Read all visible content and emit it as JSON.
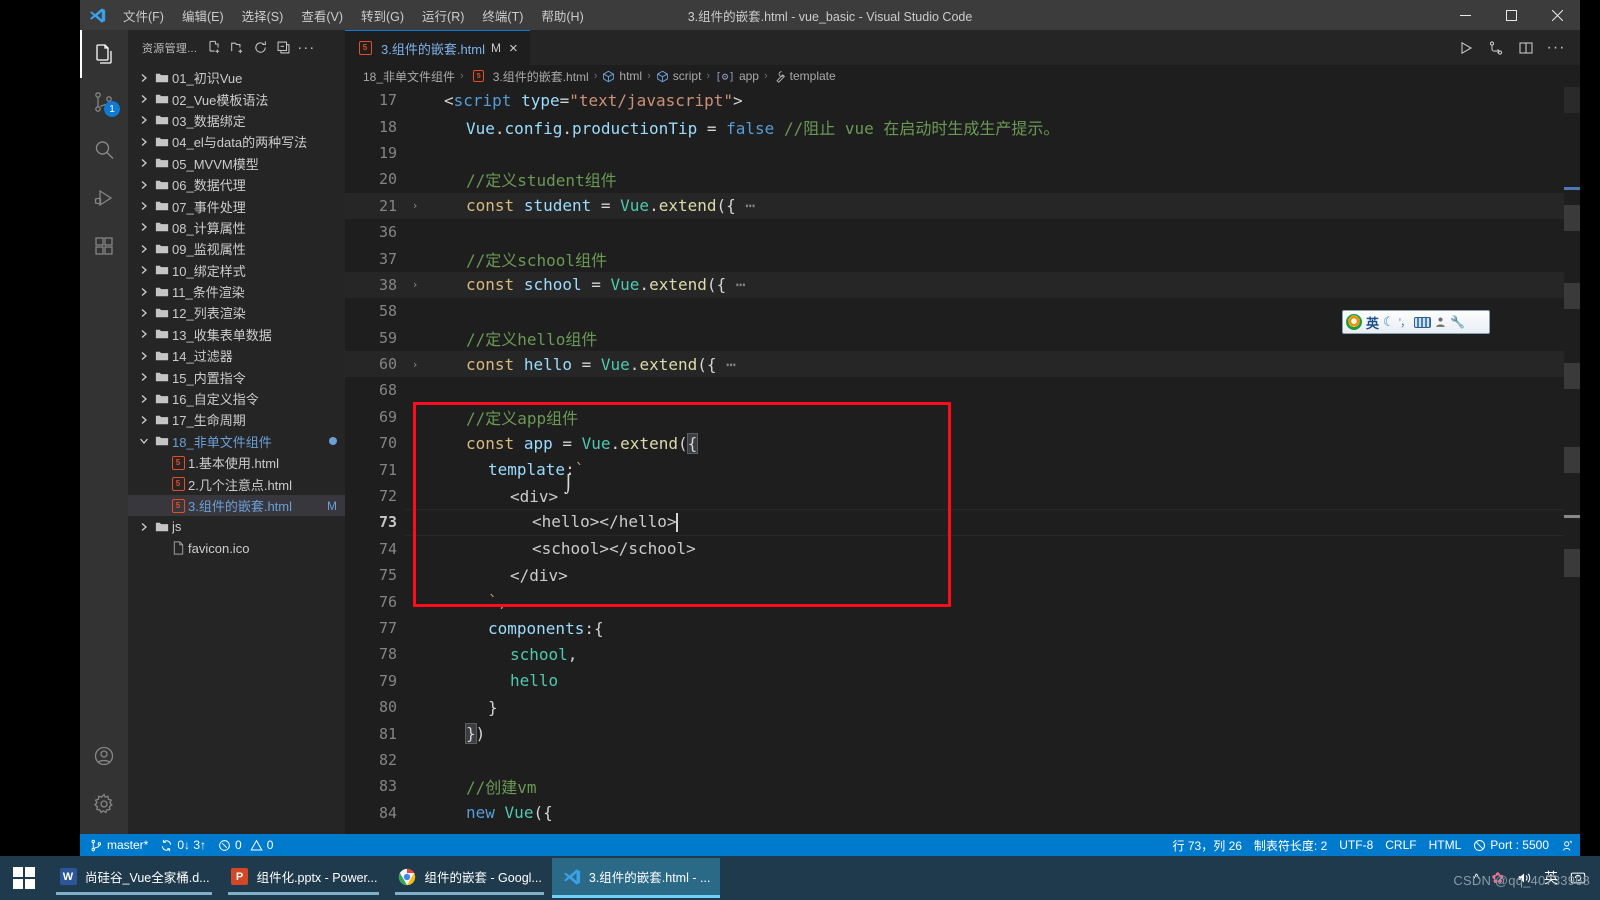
{
  "window": {
    "title": "3.组件的嵌套.html - vue_basic - Visual Studio Code",
    "menus": [
      "文件(F)",
      "编辑(E)",
      "选择(S)",
      "查看(V)",
      "转到(G)",
      "运行(R)",
      "终端(T)",
      "帮助(H)"
    ],
    "controls": {
      "minimize": "minimize-icon",
      "maximize": "maximize-icon",
      "close": "close-icon"
    }
  },
  "activitybar": {
    "items": [
      {
        "name": "explorer",
        "icon": "files-icon",
        "active": true,
        "badge": ""
      },
      {
        "name": "source-control",
        "icon": "source-control-icon",
        "active": false,
        "badge": "1"
      },
      {
        "name": "search",
        "icon": "search-icon",
        "active": false,
        "badge": ""
      },
      {
        "name": "run-and-debug",
        "icon": "debug-icon",
        "active": false,
        "badge": ""
      },
      {
        "name": "extensions",
        "icon": "extensions-icon",
        "active": false,
        "badge": ""
      }
    ],
    "bottom": [
      {
        "name": "accounts",
        "icon": "account-icon"
      },
      {
        "name": "manage",
        "icon": "gear-icon"
      }
    ]
  },
  "sidebar": {
    "title": "资源管理...",
    "actions": [
      "new-file-icon",
      "new-folder-icon",
      "refresh-icon",
      "collapse-all-icon",
      "more-icon"
    ],
    "tree": [
      {
        "label": "01_初识Vue",
        "type": "folder",
        "expanded": false,
        "indent": 0
      },
      {
        "label": "02_Vue模板语法",
        "type": "folder",
        "expanded": false,
        "indent": 0
      },
      {
        "label": "03_数据绑定",
        "type": "folder",
        "expanded": false,
        "indent": 0
      },
      {
        "label": "04_el与data的两种写法",
        "type": "folder",
        "expanded": false,
        "indent": 0
      },
      {
        "label": "05_MVVM模型",
        "type": "folder",
        "expanded": false,
        "indent": 0
      },
      {
        "label": "06_数据代理",
        "type": "folder",
        "expanded": false,
        "indent": 0
      },
      {
        "label": "07_事件处理",
        "type": "folder",
        "expanded": false,
        "indent": 0
      },
      {
        "label": "08_计算属性",
        "type": "folder",
        "expanded": false,
        "indent": 0
      },
      {
        "label": "09_监视属性",
        "type": "folder",
        "expanded": false,
        "indent": 0
      },
      {
        "label": "10_绑定样式",
        "type": "folder",
        "expanded": false,
        "indent": 0
      },
      {
        "label": "11_条件渲染",
        "type": "folder",
        "expanded": false,
        "indent": 0
      },
      {
        "label": "12_列表渲染",
        "type": "folder",
        "expanded": false,
        "indent": 0
      },
      {
        "label": "13_收集表单数据",
        "type": "folder",
        "expanded": false,
        "indent": 0
      },
      {
        "label": "14_过滤器",
        "type": "folder",
        "expanded": false,
        "indent": 0
      },
      {
        "label": "15_内置指令",
        "type": "folder",
        "expanded": false,
        "indent": 0
      },
      {
        "label": "16_自定义指令",
        "type": "folder",
        "expanded": false,
        "indent": 0
      },
      {
        "label": "17_生命周期",
        "type": "folder",
        "expanded": false,
        "indent": 0
      },
      {
        "label": "18_非单文件组件",
        "type": "folder",
        "expanded": true,
        "indent": 0,
        "modified": true,
        "highlight": true
      },
      {
        "label": "1.基本使用.html",
        "type": "html",
        "indent": 1
      },
      {
        "label": "2.几个注意点.html",
        "type": "html",
        "indent": 1
      },
      {
        "label": "3.组件的嵌套.html",
        "type": "html",
        "indent": 1,
        "selected": true,
        "badge": "M",
        "highlight": true
      },
      {
        "label": "js",
        "type": "folder",
        "expanded": false,
        "indent": 0
      },
      {
        "label": "favicon.ico",
        "type": "file",
        "indent": 1
      }
    ]
  },
  "editor": {
    "tab": {
      "label": "3.组件的嵌套.html",
      "modified_badge": "M",
      "close": "×",
      "icon": "html5-icon"
    },
    "tab_actions": [
      "run-icon",
      "split-compare-icon",
      "split-editor-icon",
      "more-actions-icon"
    ],
    "breadcrumbs": [
      {
        "label": "18_非单文件组件",
        "icon": ""
      },
      {
        "label": "3.组件的嵌套.html",
        "icon": "html5-icon"
      },
      {
        "label": "html",
        "icon": "symbol-object-icon"
      },
      {
        "label": "script",
        "icon": "symbol-object-icon"
      },
      {
        "label": "app",
        "icon": "symbol-variable-icon"
      },
      {
        "label": "template",
        "icon": "symbol-property-icon"
      }
    ],
    "cursor_caret": "|",
    "lines": [
      {
        "num": "17",
        "fold": "",
        "indent": 0,
        "tokens": [
          {
            "t": "<",
            "c": "t-punc"
          },
          {
            "t": "script",
            "c": "t-tag"
          },
          {
            "t": " ",
            "c": "t-plain"
          },
          {
            "t": "type",
            "c": "t-attr"
          },
          {
            "t": "=",
            "c": "t-punc"
          },
          {
            "t": "\"text/javascript\"",
            "c": "t-str"
          },
          {
            "t": ">",
            "c": "t-punc"
          }
        ]
      },
      {
        "num": "18",
        "fold": "",
        "indent": 1,
        "tokens": [
          {
            "t": "Vue",
            "c": "t-var"
          },
          {
            "t": ".",
            "c": "t-punc"
          },
          {
            "t": "config",
            "c": "t-var"
          },
          {
            "t": ".",
            "c": "t-punc"
          },
          {
            "t": "productionTip",
            "c": "t-var"
          },
          {
            "t": " = ",
            "c": "t-punc"
          },
          {
            "t": "false",
            "c": "t-bool"
          },
          {
            "t": " ",
            "c": "t-plain"
          },
          {
            "t": "//阻止 vue 在启动时生成生产提示。",
            "c": "t-cmt"
          }
        ]
      },
      {
        "num": "19",
        "fold": "",
        "indent": 1,
        "tokens": []
      },
      {
        "num": "20",
        "fold": "",
        "indent": 1,
        "tokens": [
          {
            "t": "//定义student组件",
            "c": "t-cmt"
          }
        ]
      },
      {
        "num": "21",
        "fold": "›",
        "indent": 1,
        "hl": true,
        "tokens": [
          {
            "t": "const",
            "c": "t-const"
          },
          {
            "t": " ",
            "c": "t-plain"
          },
          {
            "t": "student",
            "c": "t-var"
          },
          {
            "t": " = ",
            "c": "t-punc"
          },
          {
            "t": "Vue",
            "c": "t-cls"
          },
          {
            "t": ".",
            "c": "t-punc"
          },
          {
            "t": "extend",
            "c": "t-fn"
          },
          {
            "t": "({ ",
            "c": "t-punc"
          },
          {
            "t": "⋯",
            "c": "t-dots"
          }
        ]
      },
      {
        "num": "36",
        "fold": "",
        "indent": 1,
        "tokens": []
      },
      {
        "num": "37",
        "fold": "",
        "indent": 1,
        "tokens": [
          {
            "t": "//定义school组件",
            "c": "t-cmt"
          }
        ]
      },
      {
        "num": "38",
        "fold": "›",
        "indent": 1,
        "hl": true,
        "tokens": [
          {
            "t": "const",
            "c": "t-const"
          },
          {
            "t": " ",
            "c": "t-plain"
          },
          {
            "t": "school",
            "c": "t-var"
          },
          {
            "t": " = ",
            "c": "t-punc"
          },
          {
            "t": "Vue",
            "c": "t-cls"
          },
          {
            "t": ".",
            "c": "t-punc"
          },
          {
            "t": "extend",
            "c": "t-fn"
          },
          {
            "t": "({ ",
            "c": "t-punc"
          },
          {
            "t": "⋯",
            "c": "t-dots"
          }
        ]
      },
      {
        "num": "58",
        "fold": "",
        "indent": 1,
        "tokens": []
      },
      {
        "num": "59",
        "fold": "",
        "indent": 1,
        "tokens": [
          {
            "t": "//定义hello组件",
            "c": "t-cmt"
          }
        ]
      },
      {
        "num": "60",
        "fold": "›",
        "indent": 1,
        "hl": true,
        "tokens": [
          {
            "t": "const",
            "c": "t-const"
          },
          {
            "t": " ",
            "c": "t-plain"
          },
          {
            "t": "hello",
            "c": "t-var"
          },
          {
            "t": " = ",
            "c": "t-punc"
          },
          {
            "t": "Vue",
            "c": "t-cls"
          },
          {
            "t": ".",
            "c": "t-punc"
          },
          {
            "t": "extend",
            "c": "t-fn"
          },
          {
            "t": "({ ",
            "c": "t-punc"
          },
          {
            "t": "⋯",
            "c": "t-dots"
          }
        ]
      },
      {
        "num": "68",
        "fold": "",
        "indent": 1,
        "tokens": []
      },
      {
        "num": "69",
        "fold": "",
        "indent": 1,
        "tokens": [
          {
            "t": "//定义app组件",
            "c": "t-cmt"
          }
        ]
      },
      {
        "num": "70",
        "fold": "",
        "indent": 1,
        "tokens": [
          {
            "t": "const",
            "c": "t-const"
          },
          {
            "t": " ",
            "c": "t-plain"
          },
          {
            "t": "app",
            "c": "t-var"
          },
          {
            "t": " = ",
            "c": "t-punc"
          },
          {
            "t": "Vue",
            "c": "t-cls"
          },
          {
            "t": ".",
            "c": "t-punc"
          },
          {
            "t": "extend",
            "c": "t-fn"
          },
          {
            "t": "(",
            "c": "t-punc"
          },
          {
            "t": "{",
            "c": "brmatch"
          }
        ]
      },
      {
        "num": "71",
        "fold": "",
        "indent": 2,
        "tokens": [
          {
            "t": "template",
            "c": "t-prop"
          },
          {
            "t": ":",
            "c": "t-punc"
          },
          {
            "t": "`",
            "c": "t-str"
          }
        ]
      },
      {
        "num": "72",
        "fold": "",
        "indent": 3,
        "tokens": [
          {
            "t": "<div>",
            "c": "t-light"
          }
        ]
      },
      {
        "num": "73",
        "fold": "",
        "indent": 4,
        "active": true,
        "cur": true,
        "tokens": [
          {
            "t": "<hello></hello>",
            "c": "t-light"
          }
        ],
        "caret": true
      },
      {
        "num": "74",
        "fold": "",
        "indent": 4,
        "tokens": [
          {
            "t": "<school></school>",
            "c": "t-light"
          }
        ]
      },
      {
        "num": "75",
        "fold": "",
        "indent": 3,
        "tokens": [
          {
            "t": "</div>",
            "c": "t-light"
          }
        ]
      },
      {
        "num": "76",
        "fold": "",
        "indent": 2,
        "tokens": [
          {
            "t": "`,",
            "c": "t-str"
          }
        ]
      },
      {
        "num": "77",
        "fold": "",
        "indent": 2,
        "tokens": [
          {
            "t": "components",
            "c": "t-prop"
          },
          {
            "t": ":{",
            "c": "t-punc"
          }
        ]
      },
      {
        "num": "78",
        "fold": "",
        "indent": 3,
        "tokens": [
          {
            "t": "school",
            "c": "t-cls"
          },
          {
            "t": ",",
            "c": "t-punc"
          }
        ]
      },
      {
        "num": "79",
        "fold": "",
        "indent": 3,
        "tokens": [
          {
            "t": "hello",
            "c": "t-cls"
          }
        ]
      },
      {
        "num": "80",
        "fold": "",
        "indent": 2,
        "tokens": [
          {
            "t": "}",
            "c": "t-punc"
          }
        ]
      },
      {
        "num": "81",
        "fold": "",
        "indent": 1,
        "tokens": [
          {
            "t": "}",
            "c": "brmatch"
          },
          {
            "t": ")",
            "c": "t-punc"
          }
        ]
      },
      {
        "num": "82",
        "fold": "",
        "indent": 1,
        "tokens": []
      },
      {
        "num": "83",
        "fold": "",
        "indent": 1,
        "tokens": [
          {
            "t": "//创建vm",
            "c": "t-cmt"
          }
        ]
      },
      {
        "num": "84",
        "fold": "",
        "indent": 1,
        "tokens": [
          {
            "t": "new",
            "c": "t-kw"
          },
          {
            "t": " ",
            "c": "t-plain"
          },
          {
            "t": "Vue",
            "c": "t-cls"
          },
          {
            "t": "({",
            "c": "t-punc"
          }
        ]
      }
    ],
    "annotation": {
      "color": "#fd0d1b",
      "name": "red-highlight-box"
    }
  },
  "ime": {
    "items": [
      "sogou-logo-icon",
      "英",
      "moon-icon",
      "punctuation-icon",
      "keyboard-icon",
      "person-icon",
      "wrench-icon"
    ]
  },
  "statusbar": {
    "left": [
      {
        "name": "branch",
        "icon": "source-control-icon",
        "label": "master*"
      },
      {
        "name": "sync",
        "icon": "sync-icon",
        "label": "0↓ 3↑"
      },
      {
        "name": "problems",
        "icon": "error-icon",
        "label": "0",
        "label2": "0",
        "icon2": "warning-icon"
      }
    ],
    "right": [
      {
        "name": "cursor-position",
        "label": "行 73，列 26"
      },
      {
        "name": "indentation",
        "label": "制表符长度: 2"
      },
      {
        "name": "encoding",
        "label": "UTF-8"
      },
      {
        "name": "eol",
        "label": "CRLF"
      },
      {
        "name": "language-mode",
        "label": "HTML"
      },
      {
        "name": "live-server-port",
        "icon": "broadcast-icon",
        "label": "Port : 5500"
      },
      {
        "name": "feedback",
        "icon": "smiley-icon",
        "label": ""
      }
    ]
  },
  "taskbar": {
    "start": "windows-start-icon",
    "items": [
      {
        "name": "word-doc",
        "label": "尚硅谷_Vue全家桶.d...",
        "icon": "W",
        "color": "#2b579a",
        "active": false,
        "running": true
      },
      {
        "name": "powerpoint",
        "label": "组件化.pptx - Power...",
        "icon": "P",
        "color": "#d24726",
        "active": false,
        "running": true
      },
      {
        "name": "chrome",
        "label": "组件的嵌套 - Googl...",
        "icon": "chrome-icon",
        "color": "#ffffff",
        "active": false,
        "running": true
      },
      {
        "name": "vscode",
        "label": "3.组件的嵌套.html - ...",
        "icon": "vscode-icon",
        "color": "#0e7ad4",
        "active": true,
        "running": true
      }
    ],
    "tray": [
      "chevron-up-icon",
      "flower-icon",
      "volume-icon",
      "英",
      "csdn-icon"
    ],
    "watermark": "CSDN @qq_40733968"
  }
}
